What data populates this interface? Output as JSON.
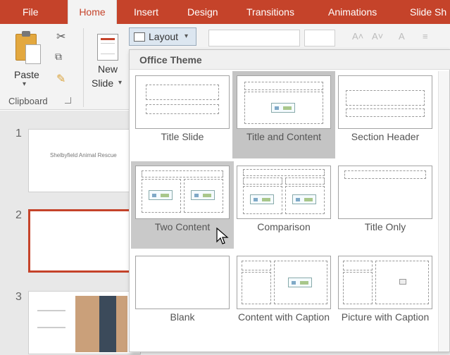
{
  "ribbon": {
    "tabs": [
      "File",
      "Home",
      "Insert",
      "Design",
      "Transitions",
      "Animations",
      "Slide Sh"
    ],
    "active_tab": "Home",
    "paste_label": "Paste",
    "new_slide_label_1": "New",
    "new_slide_label_2": "Slide",
    "layout_button_label": "Layout",
    "clipboard_group_label": "Clipboard"
  },
  "layout_gallery": {
    "section_title": "Office Theme",
    "layouts": [
      {
        "label": "Title Slide"
      },
      {
        "label": "Title and Content",
        "selected": true
      },
      {
        "label": "Section Header"
      },
      {
        "label": "Two Content",
        "hovered": true
      },
      {
        "label": "Comparison"
      },
      {
        "label": "Title Only"
      },
      {
        "label": "Blank"
      },
      {
        "label": "Content with Caption"
      },
      {
        "label": "Picture with Caption"
      }
    ]
  },
  "slides_pane": {
    "slides": [
      {
        "number": "1",
        "title": "Shelbyfield Animal Rescue"
      },
      {
        "number": "2",
        "selected": true
      },
      {
        "number": "3"
      }
    ]
  },
  "colors": {
    "accent": "#c5432a",
    "ribbon_bg": "#f3f3f3",
    "gallery_highlight": "#c9c9c9"
  }
}
